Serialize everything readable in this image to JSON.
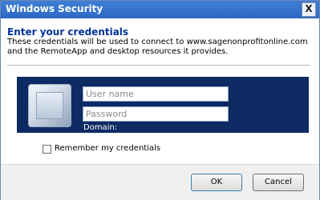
{
  "window": {
    "title": "Windows Security",
    "close_glyph": "X"
  },
  "content": {
    "heading": "Enter your credentials",
    "description": "These credentials will be used to connect to www.sagenonprofitonline.com and the RemoteApp and desktop resources it provides."
  },
  "credential_tile": {
    "username_placeholder": "User name",
    "password_placeholder": "Password",
    "domain_label": "Domain:"
  },
  "remember": {
    "label": "Remember my credentials",
    "checked": false
  },
  "buttons": {
    "ok": "OK",
    "cancel": "Cancel"
  },
  "colors": {
    "title_bar": "#2e68c4",
    "heading": "#003399",
    "tile_background": "#0d2a63"
  },
  "icons": {
    "tile_image": "user-tile-icon",
    "close": "close-icon"
  }
}
